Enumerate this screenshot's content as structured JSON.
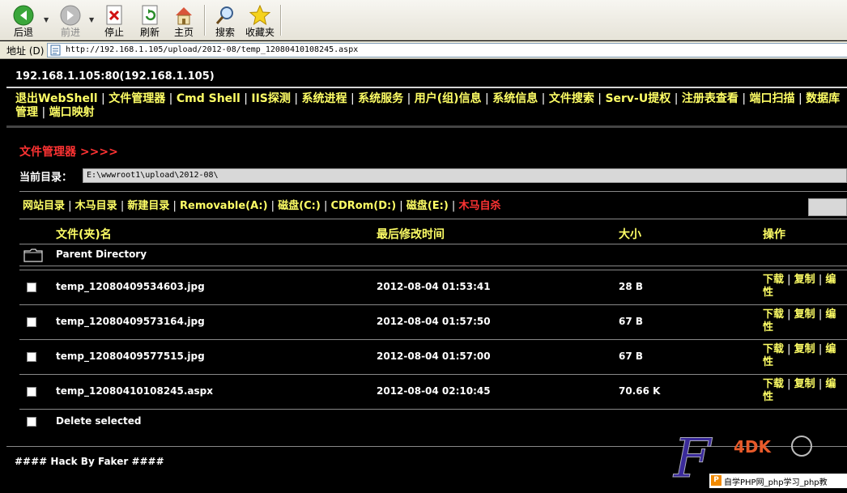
{
  "toolbar": {
    "back": "后退",
    "forward": "前进",
    "stop": "停止",
    "refresh": "刷新",
    "home": "主页",
    "search": "搜索",
    "favorites": "收藏夹"
  },
  "address": {
    "label": "地址 (D)",
    "url": "http://192.168.1.105/upload/2012-08/temp_12080410108245.aspx"
  },
  "page": {
    "host": "192.168.1.105:80(192.168.1.105)",
    "nav": [
      "退出WebShell",
      "文件管理器",
      "Cmd Shell",
      "IIS探测",
      "系统进程",
      "系统服务",
      "用户(组)信息",
      "系统信息",
      "文件搜索",
      "Serv-U提权",
      "注册表查看",
      "端口扫描",
      "数据库管理",
      "端口映射"
    ],
    "fm_title": "文件管理器 >>>>",
    "current_dir_label": "当前目录：",
    "current_dir": "E:\\wwwroot1\\upload\\2012-08\\",
    "drives": [
      "网站目录",
      "木马目录",
      "新建目录",
      "Removable(A:)",
      "磁盘(C:)",
      "CDRom(D:)",
      "磁盘(E:)"
    ],
    "self_kill": "木马自杀",
    "columns": {
      "name": "文件(夹)名",
      "mtime": "最后修改时间",
      "size": "大小",
      "ops": "操作"
    },
    "parent_dir": "Parent Directory",
    "files": [
      {
        "name": "temp_12080409534603.jpg",
        "mtime": "2012-08-04 01:53:41",
        "size": "28 B"
      },
      {
        "name": "temp_12080409573164.jpg",
        "mtime": "2012-08-04 01:57:50",
        "size": "67 B"
      },
      {
        "name": "temp_12080409577515.jpg",
        "mtime": "2012-08-04 01:57:00",
        "size": "67 B"
      },
      {
        "name": "temp_12080410108245.aspx",
        "mtime": "2012-08-04 02:10:45",
        "size": "70.66 K"
      }
    ],
    "op_download": "下载",
    "op_copy": "复制",
    "op_edit": "编",
    "op_wrap": "性",
    "delete_selected": "Delete selected",
    "footer": "#### Hack By Faker ####"
  },
  "watermark": {
    "letter": "F",
    "brand": "4DK",
    "caption": "自学PHP网_php学习_php教"
  }
}
